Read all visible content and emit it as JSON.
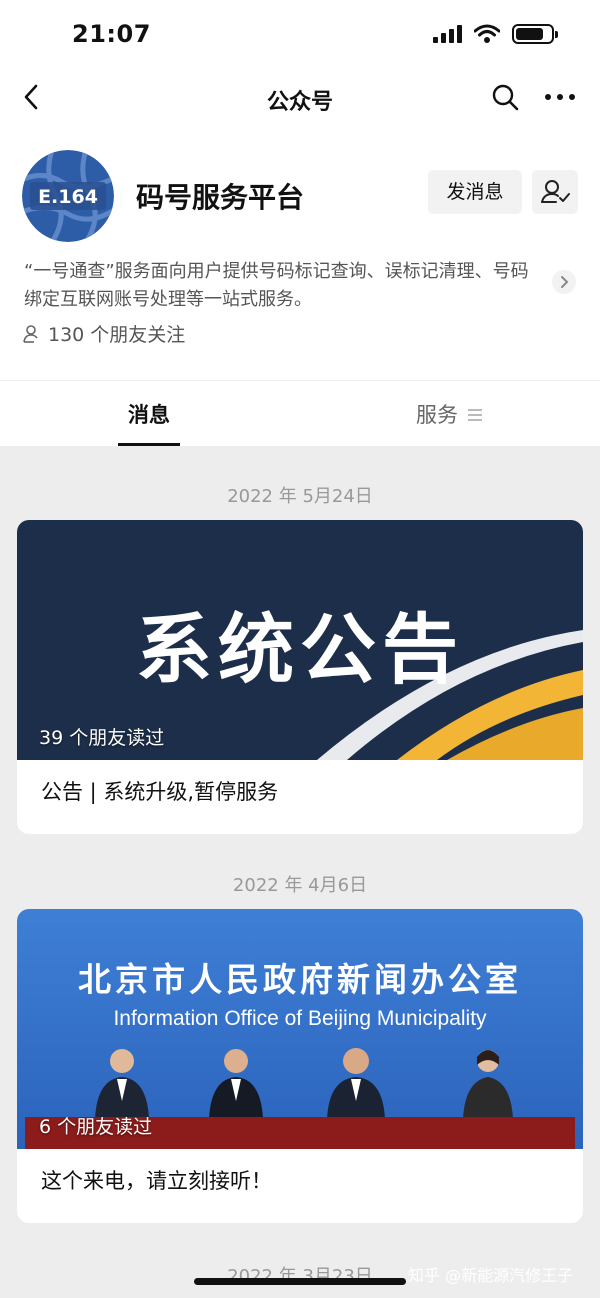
{
  "status_bar": {
    "time": "21:07"
  },
  "nav": {
    "title": "公众号"
  },
  "account": {
    "name": "码号服务平台",
    "logo_text": "E.164",
    "message_button": "发消息",
    "description": "“一号通查”服务面向用户提供号码标记查询、误标记清理、号码绑定互联网账号处理等一站式服务。",
    "followers": "130 个朋友关注"
  },
  "tabs": {
    "messages": "消息",
    "services": "服务"
  },
  "feed": [
    {
      "date": "2022 年 5月24日",
      "image_text": "系统公告",
      "reads": "39 个朋友读过",
      "caption": "公告 | 系统升级,暂停服务"
    },
    {
      "date": "2022 年 4月6日",
      "image_text_cn": "北京市人民政府新闻办公室",
      "image_text_en": "Information Office of Beijing Municipality",
      "reads": "6 个朋友读过",
      "caption": "这个来电，请立刻接听！"
    },
    {
      "date": "2022 年 3月23日"
    }
  ],
  "watermark": "知乎 @新能源汽修王子",
  "colors": {
    "nav_bg": "#ffffff",
    "feed_bg": "#ededed",
    "banner1_bg": "#1c2e4a",
    "banner1_accent": "#f2b535",
    "banner2_bg": "#3f7fd6"
  }
}
